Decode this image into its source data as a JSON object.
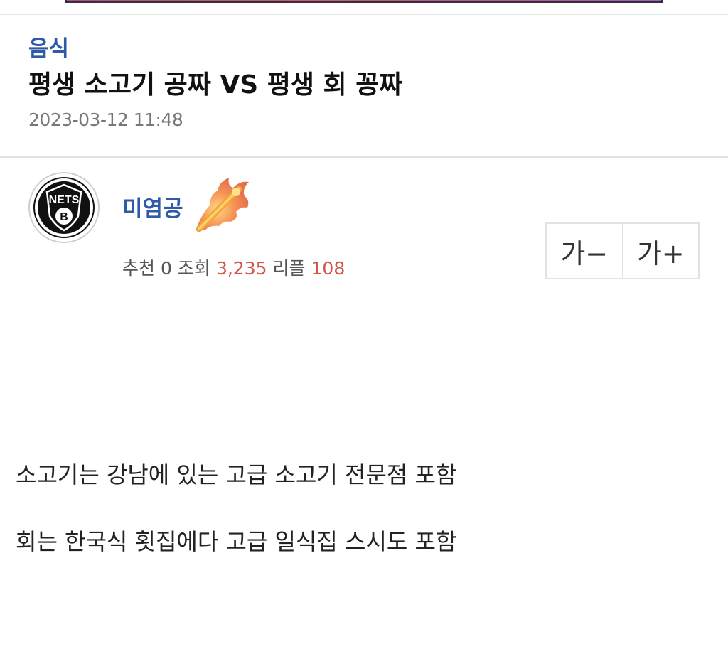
{
  "post": {
    "category": "음식",
    "title": "평생 소고기 공짜 VS 평생 회 꽁짜",
    "date": "2023-03-12 11:48"
  },
  "author": {
    "name": "미염공",
    "avatar_icon": "nets-logo-icon",
    "avatar_text": "NETS",
    "avatar_letter": "B",
    "badge_icon": "flame-rank-icon"
  },
  "stats": {
    "recommend_label": "추천",
    "recommend_value": "0",
    "views_label": "조회",
    "views_value": "3,235",
    "replies_label": "리플",
    "replies_value": "108"
  },
  "font_controls": {
    "decrease_label": "가−",
    "increase_label": "가+"
  },
  "content": {
    "lines": [
      "소고기는 강남에 있는 고급 소고기 전문점 포함",
      "회는 한국식 횟집에다 고급 일식집 스시도 포함"
    ]
  },
  "colors": {
    "accent_blue": "#2f5aa8",
    "stat_red": "#d0554b",
    "muted_gray": "#777777"
  }
}
